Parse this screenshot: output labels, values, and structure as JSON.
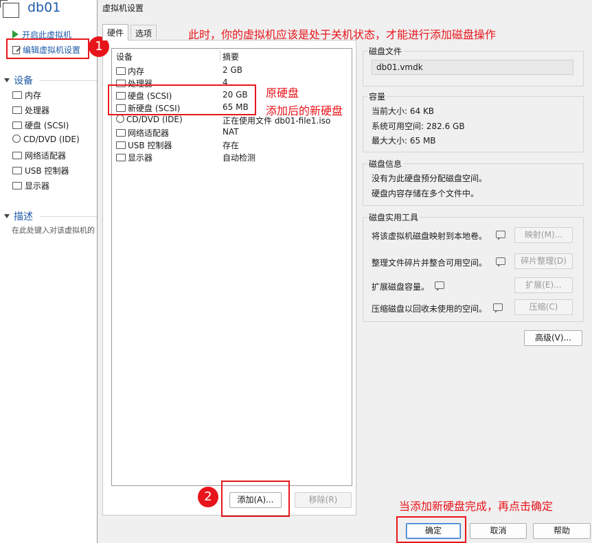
{
  "left_panel": {
    "vm_name": "db01",
    "power_on_link": "开启此虚拟机",
    "edit_settings_link": "编辑虚拟机设置",
    "devices_heading": "设备",
    "devices": [
      {
        "name": "内存",
        "icon": "memory-icon"
      },
      {
        "name": "处理器",
        "icon": "cpu-icon"
      },
      {
        "name": "硬盘 (SCSI)",
        "icon": "disk-icon"
      },
      {
        "name": "CD/DVD (IDE)",
        "icon": "cdrom-icon"
      },
      {
        "name": "网络适配器",
        "icon": "network-icon"
      },
      {
        "name": "USB 控制器",
        "icon": "usb-icon"
      },
      {
        "name": "显示器",
        "icon": "monitor-icon"
      }
    ],
    "description_heading": "描述",
    "description_placeholder": "在此处键入对该虚拟机的"
  },
  "dialog": {
    "title": "虚拟机设置",
    "tabs": [
      "硬件",
      "选项"
    ],
    "hw_headers": {
      "device": "设备",
      "summary": "摘要"
    },
    "hw_rows": [
      {
        "device": "内存",
        "summary": "2 GB",
        "icon": "memory-icon"
      },
      {
        "device": "处理器",
        "summary": "4",
        "icon": "cpu-icon"
      },
      {
        "device": "硬盘 (SCSI)",
        "summary": "20 GB",
        "icon": "disk-icon"
      },
      {
        "device": "新硬盘 (SCSI)",
        "summary": "65 MB",
        "icon": "disk-icon"
      },
      {
        "device": "CD/DVD (IDE)",
        "summary": "正在使用文件 db01-file1.iso",
        "icon": "cdrom-icon"
      },
      {
        "device": "网络适配器",
        "summary": "NAT",
        "icon": "network-icon"
      },
      {
        "device": "USB 控制器",
        "summary": "存在",
        "icon": "usb-icon"
      },
      {
        "device": "显示器",
        "summary": "自动检测",
        "icon": "monitor-icon"
      }
    ],
    "add_button": "添加(A)...",
    "remove_button": "移除(R)",
    "disk_file": {
      "title": "磁盘文件",
      "value": "db01.vmdk"
    },
    "capacity": {
      "title": "容量",
      "current": "当前大小: 64 KB",
      "available": "系统可用空间: 282.6 GB",
      "max": "最大大小: 65 MB"
    },
    "disk_info": {
      "title": "磁盘信息",
      "line1": "没有为此硬盘预分配磁盘空间。",
      "line2": "硬盘内容存储在多个文件中。"
    },
    "utilities": {
      "title": "磁盘实用工具",
      "items": [
        {
          "text": "将该虚拟机磁盘映射到本地卷。",
          "button": "映射(M)...",
          "disabled": true
        },
        {
          "text": "整理文件碎片并整合可用空间。",
          "button": "碎片整理(D)",
          "disabled": true
        },
        {
          "text": "扩展磁盘容量。",
          "button": "扩展(E)...",
          "disabled": true
        },
        {
          "text": "压缩磁盘以回收未使用的空间。",
          "button": "压缩(C)",
          "disabled": true
        }
      ]
    },
    "advanced_button": "高级(V)...",
    "ok_button": "确定",
    "cancel_button": "取消",
    "help_button": "帮助"
  },
  "annotations": {
    "top_note": "此时，你的虚拟机应该是处于关机状态，才能进行添加磁盘操作",
    "original_disk": "原硬盘",
    "new_disk": "添加后的新硬盘",
    "confirm_note": "当添加新硬盘完成，再点击确定",
    "badge1": "1",
    "badge2": "2",
    "accent_color": "#e8141b"
  }
}
